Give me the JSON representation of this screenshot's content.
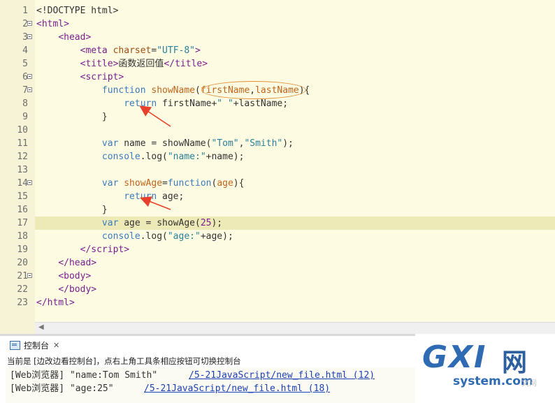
{
  "editor": {
    "lines": [
      {
        "n": "1",
        "html": "&lt;!DOCTYPE html&gt;",
        "fold": false
      },
      {
        "n": "2",
        "html": "<span class='t'>&lt;html&gt;</span>",
        "fold": true
      },
      {
        "n": "3",
        "html": "    <span class='t'>&lt;head&gt;</span>",
        "fold": true
      },
      {
        "n": "4",
        "html": "        <span class='t'>&lt;meta</span> <span class='a'>charset</span>=<span class='s'>\"UTF-8\"</span><span class='t'>&gt;</span>",
        "fold": false
      },
      {
        "n": "5",
        "html": "        <span class='t'>&lt;title&gt;</span>函数返回值<span class='t'>&lt;/title&gt;</span>",
        "fold": false
      },
      {
        "n": "6",
        "html": "        <span class='t'>&lt;script&gt;</span>",
        "fold": true
      },
      {
        "n": "7",
        "html": "            <span class='k'>function</span> <span class='f'>showName</span>(<span class='f'>firstName</span>,<span class='f'>lastName</span>){",
        "fold": true
      },
      {
        "n": "8",
        "html": "                <span class='k'>return</span> firstName+<span class='s'>\" \"</span>+lastName;",
        "fold": false
      },
      {
        "n": "9",
        "html": "            }",
        "fold": false
      },
      {
        "n": "10",
        "html": "",
        "fold": false
      },
      {
        "n": "11",
        "html": "            <span class='k'>var</span> name = showName(<span class='s'>\"Tom\"</span>,<span class='s'>\"Smith\"</span>);",
        "fold": false
      },
      {
        "n": "12",
        "html": "            <span class='k'>console</span>.log(<span class='s'>\"name:\"</span>+name);",
        "fold": false
      },
      {
        "n": "13",
        "html": "",
        "fold": false
      },
      {
        "n": "14",
        "html": "            <span class='k'>var</span> <span class='f'>showAge</span>=<span class='k'>function</span>(<span class='f'>age</span>){",
        "fold": true
      },
      {
        "n": "15",
        "html": "                <span class='k'>return</span> age;",
        "fold": false
      },
      {
        "n": "16",
        "html": "            }",
        "fold": false
      },
      {
        "n": "17",
        "html": "            <span class='k'>var</span> age = showAge(<span class='n'>25</span>);",
        "fold": false,
        "current": true
      },
      {
        "n": "18",
        "html": "            <span class='k'>console</span>.log(<span class='s'>\"age:\"</span>+age);",
        "fold": false
      },
      {
        "n": "19",
        "html": "        <span class='t'>&lt;/script&gt;</span>",
        "fold": false
      },
      {
        "n": "20",
        "html": "    <span class='t'>&lt;/head&gt;</span>",
        "fold": false
      },
      {
        "n": "21",
        "html": "    <span class='t'>&lt;body&gt;</span>",
        "fold": true
      },
      {
        "n": "22",
        "html": "    <span class='t'>&lt;/body&gt;</span>",
        "fold": false
      },
      {
        "n": "23",
        "html": "<span class='t'>&lt;/html&gt;</span>",
        "fold": false
      }
    ]
  },
  "console": {
    "tab_label": "控制台",
    "close_icon": "close-icon",
    "info": "当前是 [边改边看控制台]，点右上角工具条相应按钮可切换控制台",
    "outputs": [
      {
        "text": "[Web浏览器] \"name:Tom Smith\"",
        "link": "/5-21JavaScript/new_file.html (12)"
      },
      {
        "text": "[Web浏览器] \"age:25\"",
        "link": "/5-21JavaScript/new_file.html (18)"
      }
    ]
  },
  "watermark": {
    "big": "GXI",
    "net": "网",
    "small": "system.com",
    "faint": "文网"
  }
}
